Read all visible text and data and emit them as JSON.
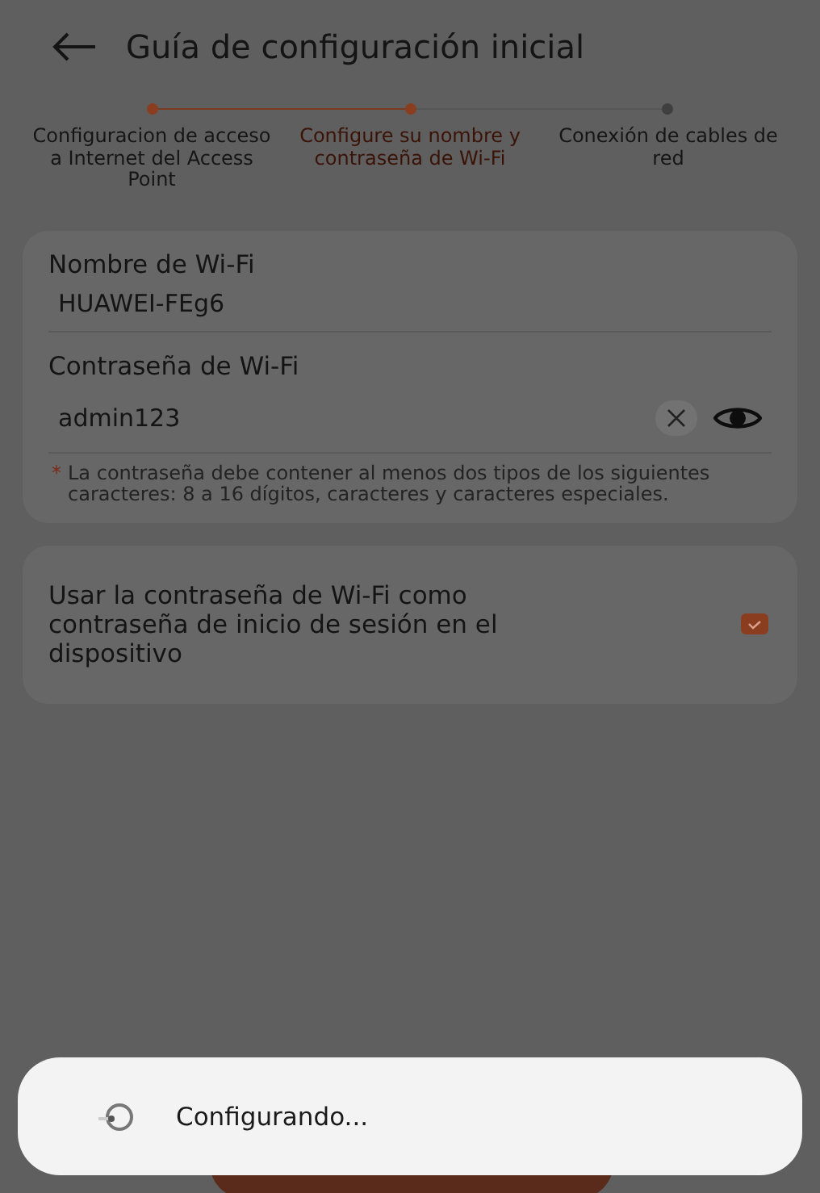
{
  "header": {
    "title": "Guía de configuración inicial"
  },
  "steps": [
    {
      "label": "Configuracion de acceso a Internet del Access Point",
      "completed": true,
      "selected": false
    },
    {
      "label": "Configure su nombre y contraseña de Wi-Fi",
      "completed": true,
      "selected": true
    },
    {
      "label": "Conexión de cables de red",
      "completed": false,
      "selected": false
    }
  ],
  "wifi_name": {
    "label": "Nombre de Wi-Fi",
    "value": "HUAWEI-FEg6"
  },
  "wifi_password": {
    "label": "Contraseña de Wi-Fi",
    "value": "admin123",
    "hint_mark": "*",
    "hint": "La contraseña debe contener al menos dos tipos de los siguientes caracteres: 8 a 16 dígitos, caracteres y caracteres especiales."
  },
  "login_option": {
    "label": "Usar la contraseña de Wi-Fi como contraseña de inicio de sesión en el dispositivo",
    "checked": true
  },
  "dialog": {
    "message": "Configurando..."
  }
}
